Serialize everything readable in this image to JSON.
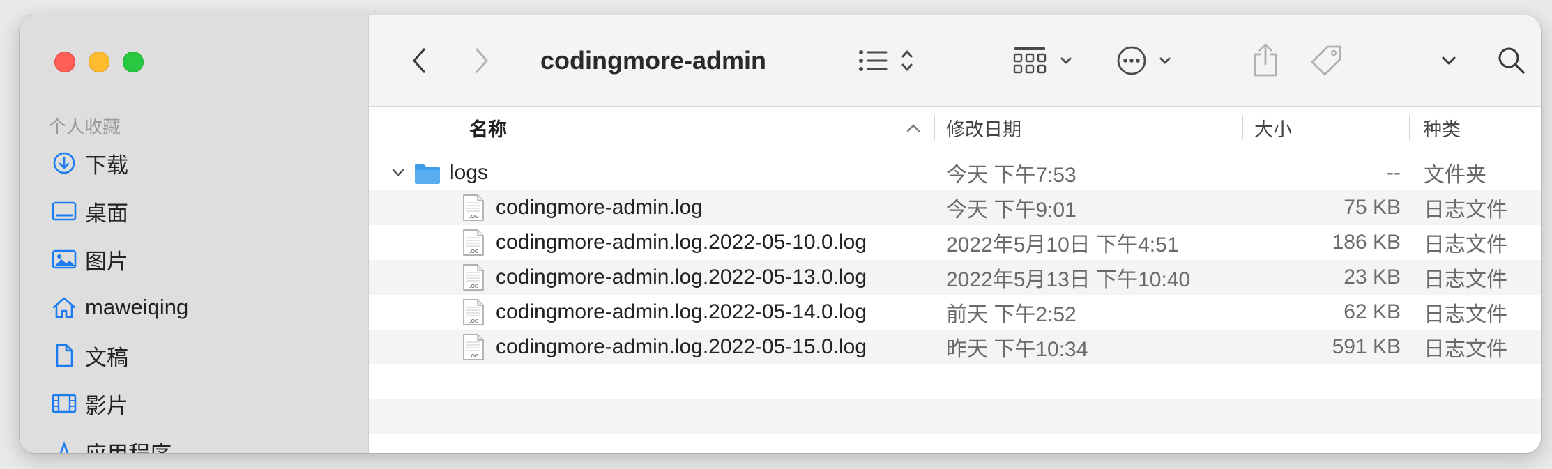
{
  "window": {
    "title": "codingmore-admin"
  },
  "sidebar": {
    "section": "个人收藏",
    "items": [
      {
        "label": "下载",
        "icon": "download-icon"
      },
      {
        "label": "桌面",
        "icon": "desktop-icon"
      },
      {
        "label": "图片",
        "icon": "photos-icon"
      },
      {
        "label": "maweiqing",
        "icon": "home-icon"
      },
      {
        "label": "文稿",
        "icon": "document-icon"
      },
      {
        "label": "影片",
        "icon": "film-icon"
      },
      {
        "label": "应用程序",
        "icon": "applications-icon"
      }
    ]
  },
  "columns": {
    "name": "名称",
    "date": "修改日期",
    "size": "大小",
    "kind": "种类"
  },
  "folder": {
    "name": "logs",
    "date": "今天 下午7:53",
    "size": "--",
    "kind": "文件夹"
  },
  "files": [
    {
      "name": "codingmore-admin.log",
      "date": "今天 下午9:01",
      "size": "75 KB",
      "kind": "日志文件"
    },
    {
      "name": "codingmore-admin.log.2022-05-10.0.log",
      "date": "2022年5月10日 下午4:51",
      "size": "186 KB",
      "kind": "日志文件"
    },
    {
      "name": "codingmore-admin.log.2022-05-13.0.log",
      "date": "2022年5月13日 下午10:40",
      "size": "23 KB",
      "kind": "日志文件"
    },
    {
      "name": "codingmore-admin.log.2022-05-14.0.log",
      "date": "前天 下午2:52",
      "size": "62 KB",
      "kind": "日志文件"
    },
    {
      "name": "codingmore-admin.log.2022-05-15.0.log",
      "date": "昨天 下午10:34",
      "size": "591 KB",
      "kind": "日志文件"
    }
  ],
  "file_icon_text": "LOG",
  "colors": {
    "accent": "#1a7cf0",
    "folder": "#5aaef0",
    "close": "#ff5f57",
    "minimize": "#febc2e",
    "maximize": "#28c840"
  }
}
